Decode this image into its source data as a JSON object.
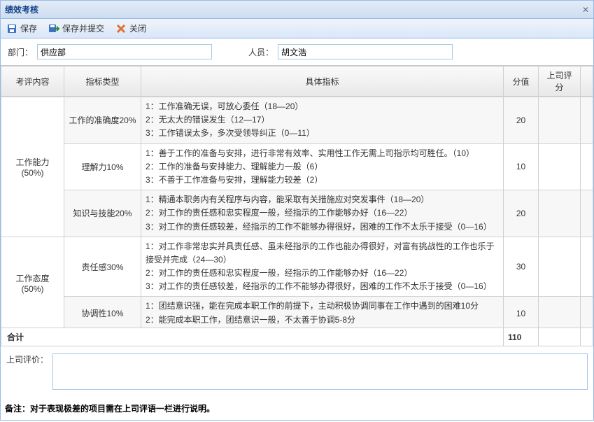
{
  "window": {
    "title": "绩效考核"
  },
  "toolbar": {
    "save": "保存",
    "save_submit": "保存并提交",
    "close": "关闭"
  },
  "form": {
    "dept_label": "部门：",
    "dept_value": "供应部",
    "person_label": "人员：",
    "person_value": "胡文浩"
  },
  "headers": {
    "category": "考评内容",
    "type": "指标类型",
    "detail": "具体指标",
    "score": "分值",
    "mgr_score": "上司评分"
  },
  "rows": [
    {
      "category": "工作能力(50%)",
      "cat_rowspan": 3,
      "type": "工作的准确度20%",
      "detail": "1：工作准确无误，可放心委任（18—20）\n2：无太大的错误发生（12—17）\n3：工作错误太多，多次受领导纠正（0—11）",
      "score": "20",
      "alt": true
    },
    {
      "type": "理解力10%",
      "detail": "1：善于工作的准备与安排，进行非常有效率、实用性工作无需上司指示均可胜任。（10）\n2：工作的准备与安排能力、理解能力一般（6）\n3：不善于工作准备与安排，理解能力较差（2）",
      "score": "10"
    },
    {
      "type": "知识与技能20%",
      "detail": "1：精通本职务内有关程序与内容，能采取有关措施应对突发事件（18—20）\n2：对工作的责任感和忠实程度一般，经指示的工作能够办好（16—22）\n3：对工作的责任感较差，经指示的工作不能够办得很好，困难的工作不太乐于接受（0—16）",
      "score": "20",
      "alt": true
    },
    {
      "category": "工作态度(50%)",
      "cat_rowspan": 2,
      "type": "责任感30%",
      "detail": "1：对工作非常忠实并具责任感、虽未经指示的工作也能办得很好，对富有挑战性的工作也乐于接受并完成（24—30）\n2：对工作的责任感和忠实程度一般，经指示的工作能够办好（16—22）\n3：对工作的责任感较差，经指示的工作不能够办得很好，困难的工作不太乐于接受（0—16）",
      "score": "30"
    },
    {
      "type": "协调性10%",
      "detail": "1：团结意识强，能在完成本职工作的前提下，主动积极协调同事在工作中遇到的困难10分\n2：能完成本职工作，团结意识一般，不太善于协调5-8分",
      "score": "10",
      "alt": true
    }
  ],
  "total": {
    "label": "合计",
    "value": "110"
  },
  "comment": {
    "label": "上司评价：",
    "value": ""
  },
  "note": "备注：对于表现极差的项目需在上司评语一栏进行说明。"
}
